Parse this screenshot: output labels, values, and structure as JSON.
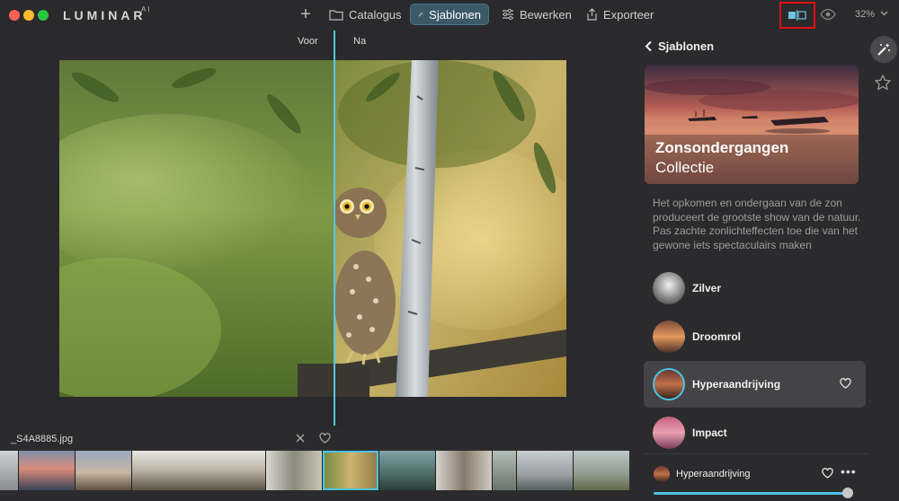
{
  "app": {
    "logo": "LUMINAR",
    "logo_sup": "AI"
  },
  "toolbar": {
    "add_label": "+",
    "catalog_label": "Catalogus",
    "templates_label": "Sjablonen",
    "edit_label": "Bewerken",
    "export_label": "Exporteer",
    "zoom_value": "32%"
  },
  "compare": {
    "before_label": "Voor",
    "after_label": "Na"
  },
  "filmstrip": {
    "file_name": "_S4A8885.jpg",
    "selected_index": 6
  },
  "panel": {
    "back_label": "Sjablonen",
    "collection_title": "Zonsondergangen",
    "collection_subtitle": "Collectie",
    "description": "Het opkomen en ondergaan van de zon produceert de grootste show van de natuur. Pas zachte zonlichteffecten toe die van het gewone iets spectaculairs maken",
    "templates": [
      {
        "name": "Zilver"
      },
      {
        "name": "Droomrol"
      },
      {
        "name": "Hyperaandrijving",
        "active": true
      },
      {
        "name": "Impact"
      }
    ],
    "applied_template": "Hyperaandrijving",
    "more_label": "•••",
    "amount_fraction": 1.0
  },
  "colors": {
    "accent": "#4cc3e8",
    "highlight_box": "#e01010",
    "active_tab": "#3c5968"
  }
}
